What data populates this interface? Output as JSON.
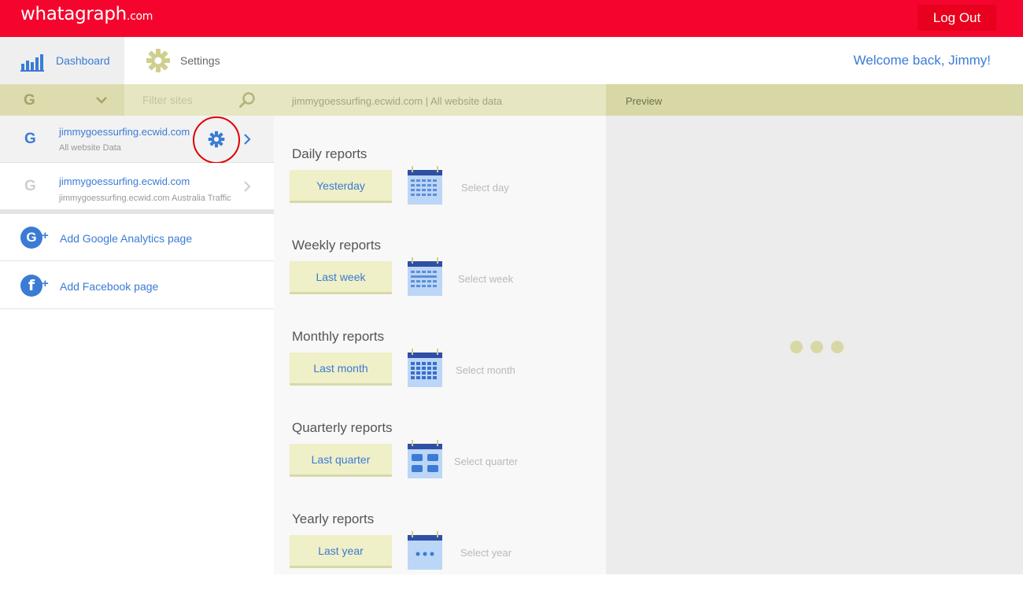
{
  "header": {
    "logo_main": "whatagraph",
    "logo_domain": ".com",
    "logout_label": "Log Out",
    "bg_color": "#f5052d"
  },
  "nav": {
    "dashboard_label": "Dashboard",
    "settings_label": "Settings",
    "welcome": "Welcome back, Jimmy!"
  },
  "sidebar": {
    "source_icon_letter": "G",
    "filter_placeholder": "Filter sites",
    "sites": [
      {
        "icon_letter": "G",
        "title": "jimmygoessurfing.ecwid.com",
        "subtitle": "All website Data",
        "active": true
      },
      {
        "icon_letter": "G",
        "title": "jimmygoessurfing.ecwid.com",
        "subtitle": "jimmygoessurfing.ecwid.com Australia Traffic",
        "active": false
      }
    ],
    "add_google": {
      "icon_letter": "G",
      "plus": "+",
      "label": "Add Google Analytics page"
    },
    "add_facebook": {
      "icon_letter": "f",
      "plus": "+",
      "label": "Add Facebook page"
    }
  },
  "middle": {
    "header": "jimmygoessurfing.ecwid.com | All website data",
    "reports": [
      {
        "title": "Daily reports",
        "button": "Yesterday",
        "select": "Select day",
        "calendar": "grid"
      },
      {
        "title": "Weekly reports",
        "button": "Last week",
        "select": "Select week",
        "calendar": "grid"
      },
      {
        "title": "Monthly reports",
        "button": "Last month",
        "select": "Select month",
        "calendar": "grid-dark"
      },
      {
        "title": "Quarterly reports",
        "button": "Last quarter",
        "select": "Select quarter",
        "calendar": "quarters"
      },
      {
        "title": "Yearly reports",
        "button": "Last year",
        "select": "Select year",
        "calendar": "dots"
      }
    ]
  },
  "preview": {
    "header": "Preview",
    "loading": "loading-dots"
  },
  "colors": {
    "accent": "#3a7bd5",
    "olive": "#e6e6c2",
    "olive_dark": "#d8d8a6"
  }
}
